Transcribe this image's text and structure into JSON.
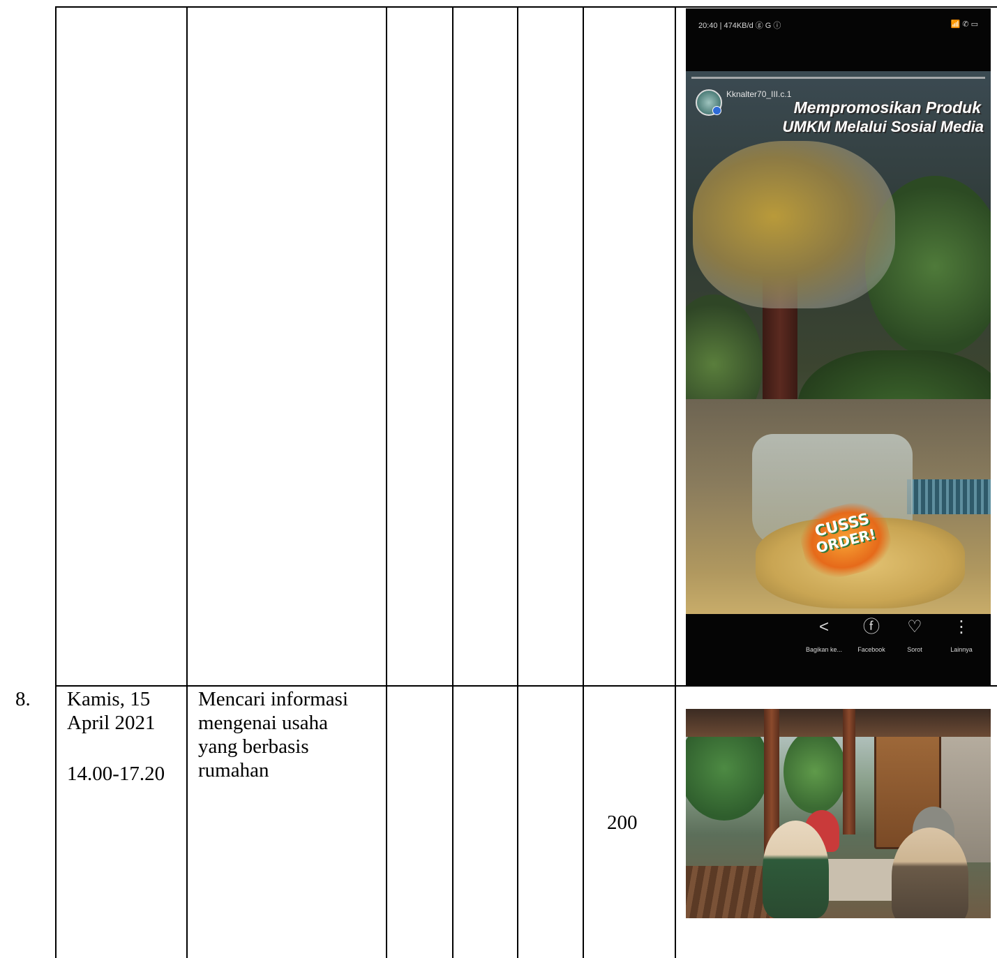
{
  "row8": {
    "number": "8.",
    "date_line1": "Kamis, 15",
    "date_line2": "April 2021",
    "time": "14.00-17.20",
    "activity_lines": [
      "Mencari informasi",
      "mengenai usaha",
      "yang berbasis",
      "rumahan"
    ],
    "value": "200"
  },
  "story_screenshot": {
    "status_left": "20:40 | 474KB/d ⓖ G ⓘ",
    "status_right": "📶 ✆ ▭",
    "username": "Kknalter70_III.c.1",
    "headline_line1": "Mempromosikan Produk",
    "headline_line2": "UMKM Melalui Sosial Media",
    "sticker_line1": "CUSSS",
    "sticker_line2": "ORDER!",
    "actions": [
      {
        "icon": "share-icon",
        "glyph": "<",
        "label": "Bagikan ke..."
      },
      {
        "icon": "facebook-icon",
        "glyph": "ⓕ",
        "label": "Facebook"
      },
      {
        "icon": "sorot-icon",
        "glyph": "♡",
        "label": "Sorot"
      },
      {
        "icon": "more-icon",
        "glyph": "⋮",
        "label": "Lainnya"
      }
    ]
  }
}
